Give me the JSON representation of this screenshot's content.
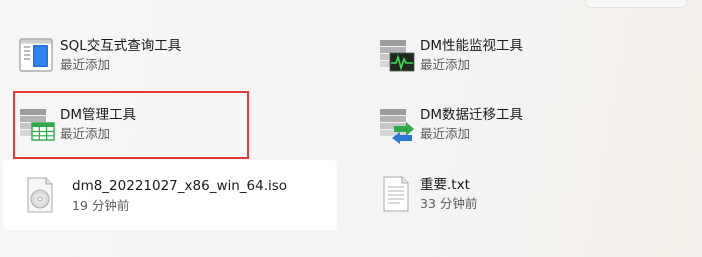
{
  "recent": {
    "items": [
      {
        "title": "SQL交互式查询工具",
        "subtitle": "最近添加"
      },
      {
        "title": "DM性能监视工具",
        "subtitle": "最近添加"
      },
      {
        "title": "DM管理工具",
        "subtitle": "最近添加"
      },
      {
        "title": "DM数据迁移工具",
        "subtitle": "最近添加"
      },
      {
        "title": "dm8_20221027_x86_win_64.iso",
        "subtitle": "19 分钟前"
      },
      {
        "title": "重要.txt",
        "subtitle": "33 分钟前"
      }
    ]
  },
  "icons": {
    "sql": "sql-query-tool-icon",
    "monitor": "performance-monitor-icon",
    "manager": "dm-manager-icon",
    "migration": "data-migration-icon",
    "iso": "disc-image-icon",
    "txt": "text-file-icon"
  },
  "colors": {
    "highlight_border": "#e03a3a",
    "grid_green": "#2eaa4a",
    "migration_blue": "#2a78d6"
  }
}
